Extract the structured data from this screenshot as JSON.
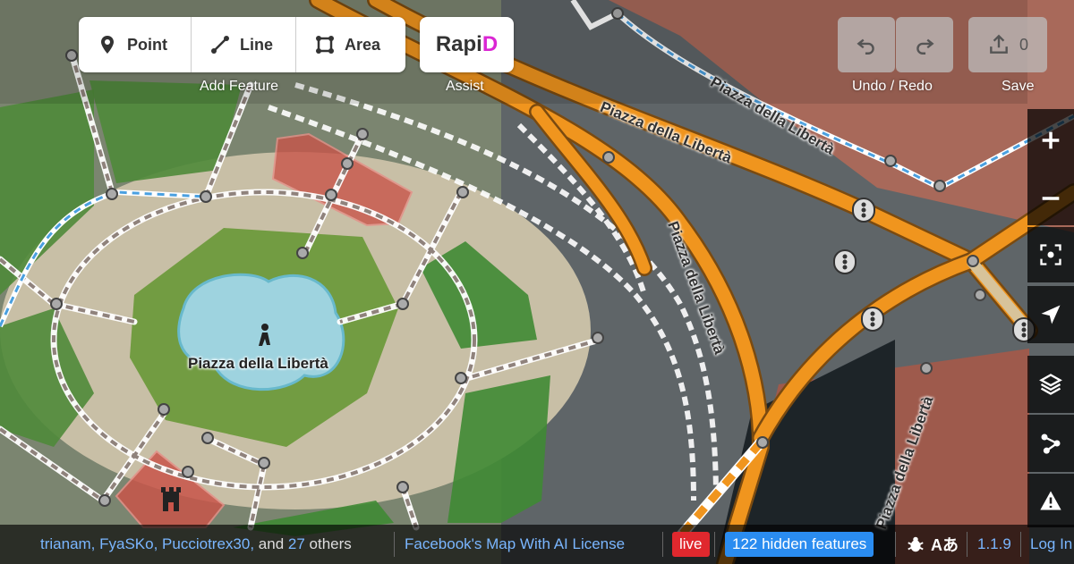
{
  "toolbar": {
    "point_label": "Point",
    "line_label": "Line",
    "area_label": "Area",
    "add_feature_label": "Add Feature",
    "rapid_prefix": "Rapi",
    "rapid_suffix": "D",
    "assist_label": "Assist",
    "undo_redo_label": "Undo / Redo",
    "save_label": "Save",
    "save_count": "0"
  },
  "map": {
    "feature_label": "Piazza della Libertà",
    "street_labels": [
      "Piazza della Libertà",
      "Piazza della Libertà",
      "Piazza della Libertà",
      "Piazza della Libertà"
    ]
  },
  "footer": {
    "contributors": "trianam, FyaSKo, Pucciotrex30,",
    "and_word": "and",
    "others_count": "27",
    "others_word": "others",
    "license_link": "Facebook's Map With AI License",
    "live_badge": "live",
    "hidden_features": "122 hidden features",
    "translate_glyph": "Aあ",
    "version": "1.1.9",
    "login": "Log In"
  },
  "icons": [
    "point-icon",
    "line-icon",
    "area-icon",
    "undo-icon",
    "redo-icon",
    "upload-icon",
    "zoom-in-icon",
    "zoom-out-icon",
    "zoom-to-selection-icon",
    "geolocate-icon",
    "layers-icon",
    "map-data-icon",
    "issues-icon",
    "bug-icon",
    "pedestrian-icon",
    "castle-icon"
  ],
  "colors": {
    "primary_road": "#f0951e",
    "rapid_accent": "#da26d3",
    "live": "#e0282e",
    "hidden_features": "#2a8cf0",
    "link": "#7ab6ff"
  }
}
